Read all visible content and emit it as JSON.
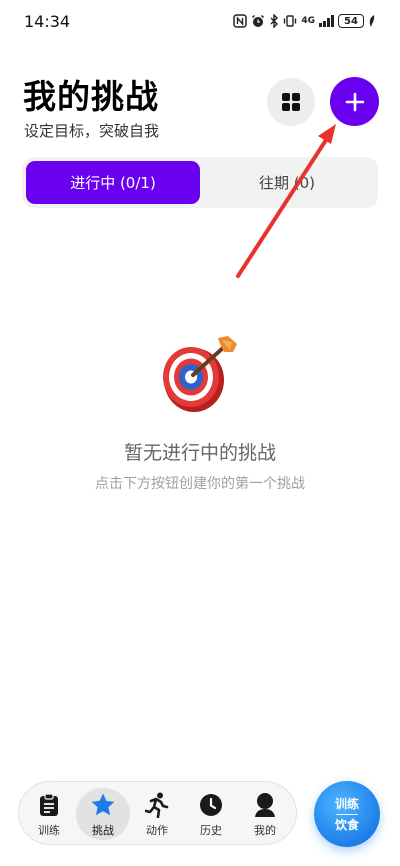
{
  "status": {
    "time": "14:34",
    "network": "4G",
    "battery": "54"
  },
  "header": {
    "title": "我的挑战",
    "subtitle": "设定目标，突破自我"
  },
  "tabs": [
    {
      "label": "进行中 (0/1)",
      "active": true
    },
    {
      "label": "往期 (0)",
      "active": false
    }
  ],
  "empty_state": {
    "icon": "bullseye-target-icon",
    "title": "暂无进行中的挑战",
    "description": "点击下方按钮创建你的第一个挑战"
  },
  "bottom_nav": {
    "items": [
      {
        "label": "训练",
        "icon": "clipboard-icon",
        "active": false
      },
      {
        "label": "挑战",
        "icon": "star-icon",
        "active": true
      },
      {
        "label": "动作",
        "icon": "running-icon",
        "active": false
      },
      {
        "label": "历史",
        "icon": "clock-icon",
        "active": false
      },
      {
        "label": "我的",
        "icon": "user-icon",
        "active": false
      }
    ]
  },
  "switch_button": {
    "top": "训练",
    "bottom": "饮食"
  },
  "colors": {
    "accent": "#6a00f0",
    "nav_active_star": "#1e7be8",
    "switch_blue": "#1d7fe8",
    "annotation_red": "#e8322e"
  }
}
